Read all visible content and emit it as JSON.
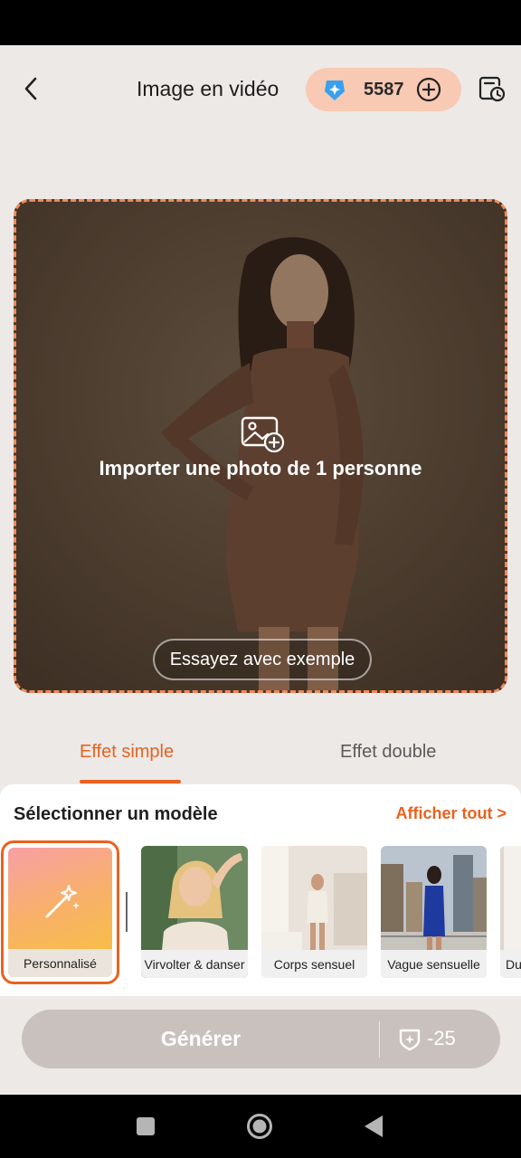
{
  "header": {
    "title": "Image en vidéo",
    "credits": "5587"
  },
  "upload": {
    "prompt": "Importer une photo de 1 personne",
    "example_button": "Essayez avec exemple"
  },
  "tabs": [
    {
      "label": "Effet simple",
      "active": true
    },
    {
      "label": "Effet double",
      "active": false
    }
  ],
  "templates": {
    "section_title": "Sélectionner un modèle",
    "see_all": "Afficher tout >",
    "items": [
      {
        "label": "Personnalisé",
        "selected": true
      },
      {
        "label": "Virvolter & danser"
      },
      {
        "label": "Corps sensuel"
      },
      {
        "label": "Vague sensuelle"
      },
      {
        "label": "Du"
      }
    ]
  },
  "generate": {
    "label": "Générer",
    "cost": "-25"
  },
  "colors": {
    "accent": "#e8621f",
    "credits_pill": "#f8c9b3",
    "generate_disabled": "#c8c1bd",
    "background": "#ece9e7"
  }
}
